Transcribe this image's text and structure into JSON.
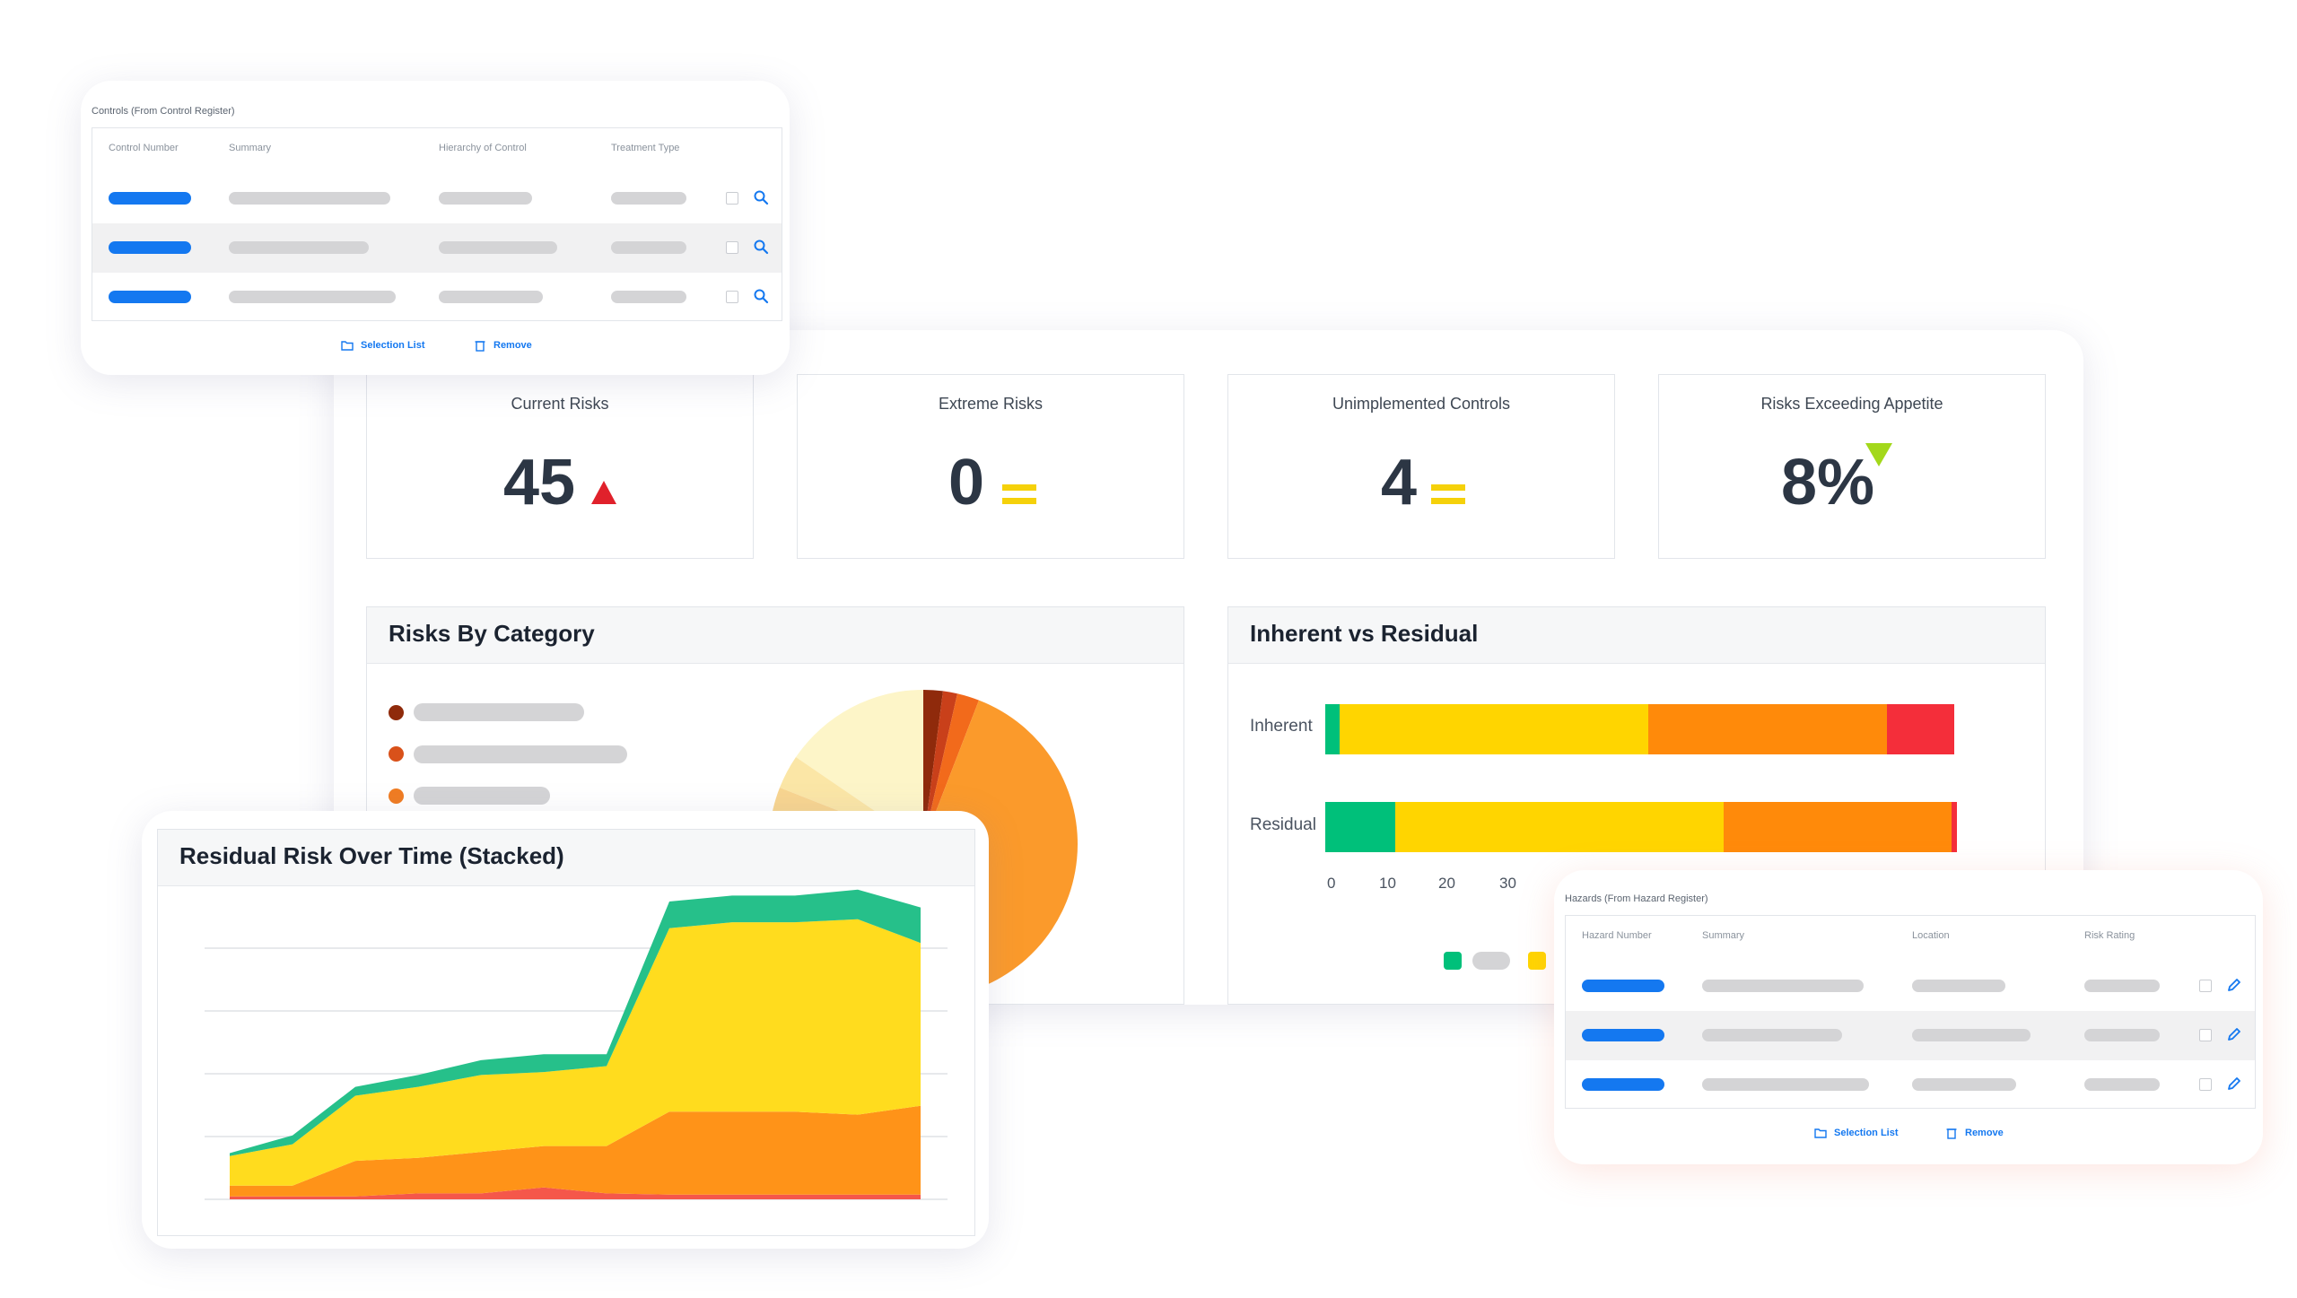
{
  "kpis": [
    {
      "label": "Current Risks",
      "value": "45",
      "trend": "up",
      "trend_color": "#e0212b"
    },
    {
      "label": "Extreme Risks",
      "value": "0",
      "trend": "flat",
      "trend_color": "#f5d10a"
    },
    {
      "label": "Unimplemented Controls",
      "value": "4",
      "trend": "flat",
      "trend_color": "#f5d10a"
    },
    {
      "label": "Risks Exceeding Appetite",
      "value": "8%",
      "trend": "down",
      "trend_color": "#a3d81b"
    }
  ],
  "risks_by_category": {
    "title": "Risks By Category",
    "legend_colors": [
      "#8f2a0b",
      "#d9511a",
      "#f07c22"
    ],
    "slice_colors": [
      "#8f2a0b",
      "#c9401a",
      "#f26a1b",
      "#fb9a2b",
      "#fdf5c8",
      "#fbe6a6",
      "#f8d590",
      "#f5c27a"
    ]
  },
  "inherent_vs_residual": {
    "title": "Inherent vs Residual",
    "rows": [
      {
        "label": "Inherent",
        "segments": [
          {
            "color": "#00c07a",
            "value": 0.5
          },
          {
            "color": "#ffd500",
            "value": 11
          },
          {
            "color": "#ff8a0a",
            "value": 8.5
          },
          {
            "color": "#f42e3a",
            "value": 2.4
          }
        ]
      },
      {
        "label": "Residual",
        "segments": [
          {
            "color": "#00c07a",
            "value": 2.5
          },
          {
            "color": "#ffd500",
            "value": 11.7
          },
          {
            "color": "#ff8a0a",
            "value": 8.1
          },
          {
            "color": "#f42e3a",
            "value": 0.2
          }
        ]
      }
    ],
    "ticks": [
      "0",
      "10",
      "20",
      "30"
    ],
    "legend_colors": [
      "#00c07a",
      "#ffd500"
    ]
  },
  "residual_over_time": {
    "title": "Residual Risk Over Time (Stacked)"
  },
  "chart_data": {
    "type": "area",
    "title": "Residual Risk Over Time (Stacked)",
    "x": [
      0,
      1,
      2,
      3,
      4,
      5,
      6,
      7,
      8,
      9,
      10,
      11
    ],
    "ylim": [
      0,
      50
    ],
    "series": [
      {
        "color": "#f5574a",
        "values": [
          0.5,
          0.5,
          0.5,
          1,
          1,
          2,
          1,
          0.8,
          0.8,
          0.8,
          0.8,
          0.8
        ]
      },
      {
        "color": "#ff9318",
        "values": [
          1.8,
          1.8,
          6,
          6,
          7,
          7,
          8,
          14,
          14,
          14,
          13.5,
          15
        ]
      },
      {
        "color": "#ffdc1e",
        "values": [
          5,
          7,
          11,
          12,
          13,
          12.5,
          13.5,
          31,
          32,
          32,
          33,
          27.5
        ]
      },
      {
        "color": "#26c08a",
        "values": [
          0.5,
          1.5,
          1.5,
          2,
          2.5,
          3,
          2,
          4.5,
          4.5,
          4.5,
          5,
          6
        ]
      }
    ]
  },
  "controls_table": {
    "caption": "Controls (From Control Register)",
    "headers": [
      "Control Number",
      "Summary",
      "Hierarchy of Control",
      "Treatment Type"
    ],
    "rows": 3,
    "actions": {
      "selection": "Selection List",
      "remove": "Remove"
    }
  },
  "hazards_table": {
    "caption": "Hazards (From Hazard Register)",
    "headers": [
      "Hazard Number",
      "Summary",
      "Location",
      "Risk Rating"
    ],
    "rows": 3,
    "actions": {
      "selection": "Selection List",
      "remove": "Remove"
    }
  }
}
